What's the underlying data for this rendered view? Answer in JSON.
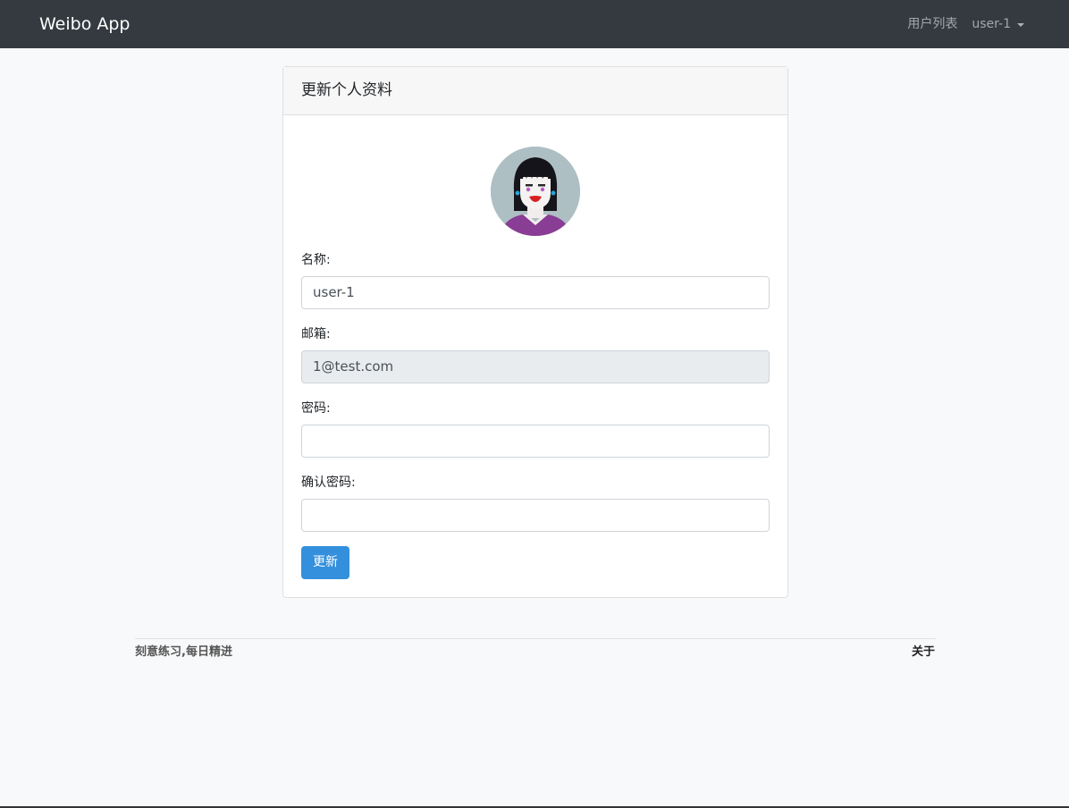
{
  "navbar": {
    "brand": "Weibo App",
    "users_link": "用户列表",
    "user_menu": "user-1"
  },
  "card": {
    "title": "更新个人资料"
  },
  "form": {
    "name_label": "名称:",
    "name_value": "user-1",
    "email_label": "邮箱:",
    "email_value": "1@test.com",
    "password_label": "密码:",
    "password_value": "",
    "confirm_label": "确认密码:",
    "confirm_value": "",
    "submit_label": "更新"
  },
  "footer": {
    "slogan": "刻意练习,每日精进",
    "about_link": "关于"
  },
  "colors": {
    "navbar_bg": "#343a40",
    "primary": "#3490dc",
    "page_bg": "#f8f9fa"
  }
}
